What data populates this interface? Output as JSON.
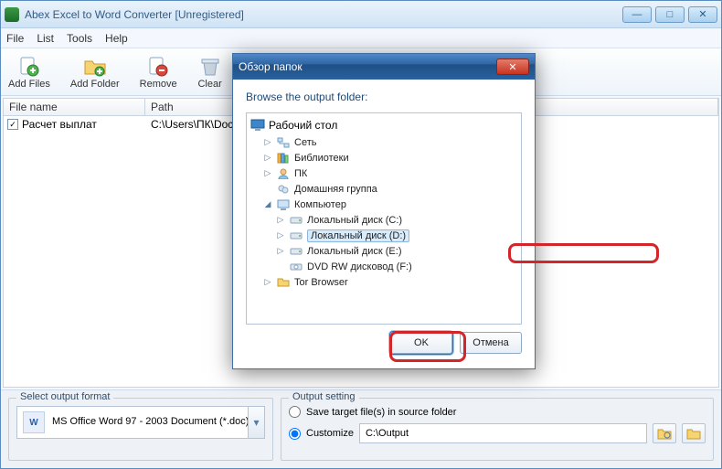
{
  "window": {
    "title": "Abex Excel to Word Converter [Unregistered]"
  },
  "menu": {
    "file": "File",
    "list": "List",
    "tools": "Tools",
    "help": "Help"
  },
  "toolbar": {
    "add_files": "Add Files",
    "add_folder": "Add Folder",
    "remove": "Remove",
    "clear": "Clear"
  },
  "grid": {
    "col_name": "File name",
    "col_path": "Path",
    "rows": [
      {
        "checked": true,
        "name": "Расчет выплат",
        "path": "C:\\Users\\ПК\\Doc"
      }
    ]
  },
  "format_group": {
    "title": "Select output format",
    "combo_label": "MS Office Word 97 - 2003 Document (*.doc)",
    "icon_text": "W"
  },
  "output_group": {
    "title": "Output setting",
    "radio_source": "Save target file(s) in source folder",
    "radio_custom": "Customize",
    "path": "C:\\Output"
  },
  "dialog": {
    "title": "Обзор папок",
    "label": "Browse the output folder:",
    "root": "Рабочий стол",
    "items": {
      "network": "Сеть",
      "libraries": "Библиотеки",
      "pc": "ПК",
      "homegroup": "Домашняя группа",
      "computer": "Компьютер",
      "disk_c": "Локальный диск (C:)",
      "disk_d": "Локальный диск (D:)",
      "disk_e": "Локальный диск (E:)",
      "dvd_f": "DVD RW дисковод (F:)",
      "tor": "Tor Browser"
    },
    "ok": "OK",
    "cancel": "Отмена"
  }
}
